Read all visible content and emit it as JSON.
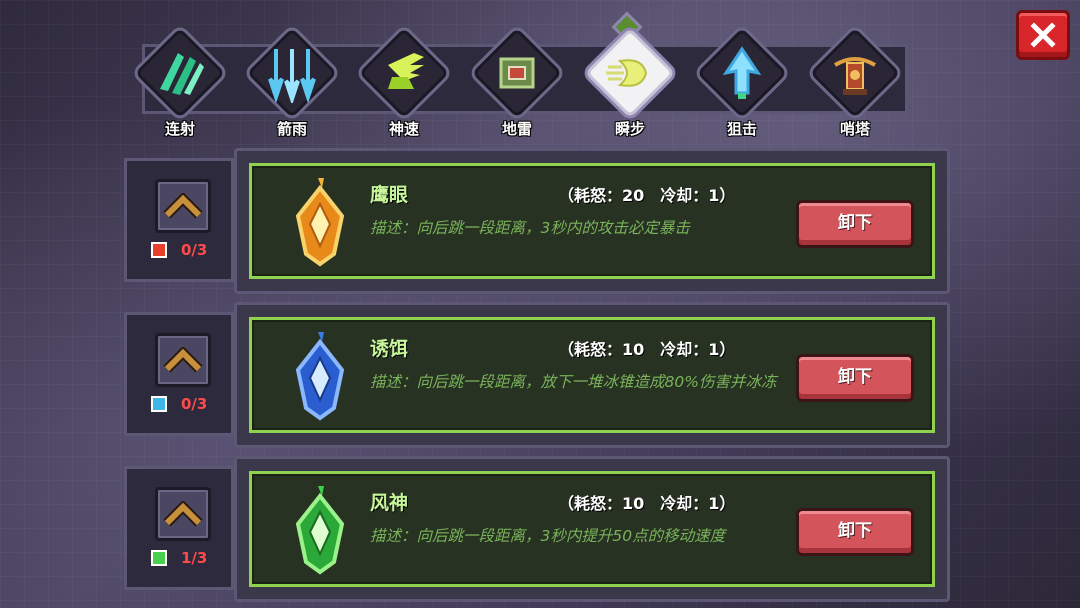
{
  "tabs": [
    {
      "label": "连射",
      "icon": "triple-claw-icon"
    },
    {
      "label": "箭雨",
      "icon": "arrow-rain-icon"
    },
    {
      "label": "神速",
      "icon": "winged-boot-icon"
    },
    {
      "label": "地雷",
      "icon": "landmine-icon"
    },
    {
      "label": "瞬步",
      "icon": "dash-wind-icon",
      "active": true
    },
    {
      "label": "狙击",
      "icon": "snipe-arrow-icon"
    },
    {
      "label": "哨塔",
      "icon": "crossbow-tower-icon"
    }
  ],
  "skills": [
    {
      "name": "鹰眼",
      "stats": "（耗怒：20　冷却：1）",
      "desc": "描述：向后跳一段距离，3秒内的攻击必定暴击",
      "level": "0/3",
      "button": "卸下",
      "gem_color": "#f2b53a",
      "level_icon_color": "#e8402a"
    },
    {
      "name": "诱饵",
      "stats": "（耗怒：10　冷却：1）",
      "desc": "描述：向后跳一段距离，放下一堆冰锥造成80%伤害并冰冻",
      "level": "0/3",
      "button": "卸下",
      "gem_color": "#3a7ae8",
      "level_icon_color": "#3fb6e8"
    },
    {
      "name": "风神",
      "stats": "（耗怒：10　冷却：1）",
      "desc": "描述：向后跳一段距离，3秒内提升50点的移动速度",
      "level": "1/3",
      "button": "卸下",
      "gem_color": "#3ed24a",
      "level_icon_color": "#47d14e"
    }
  ]
}
